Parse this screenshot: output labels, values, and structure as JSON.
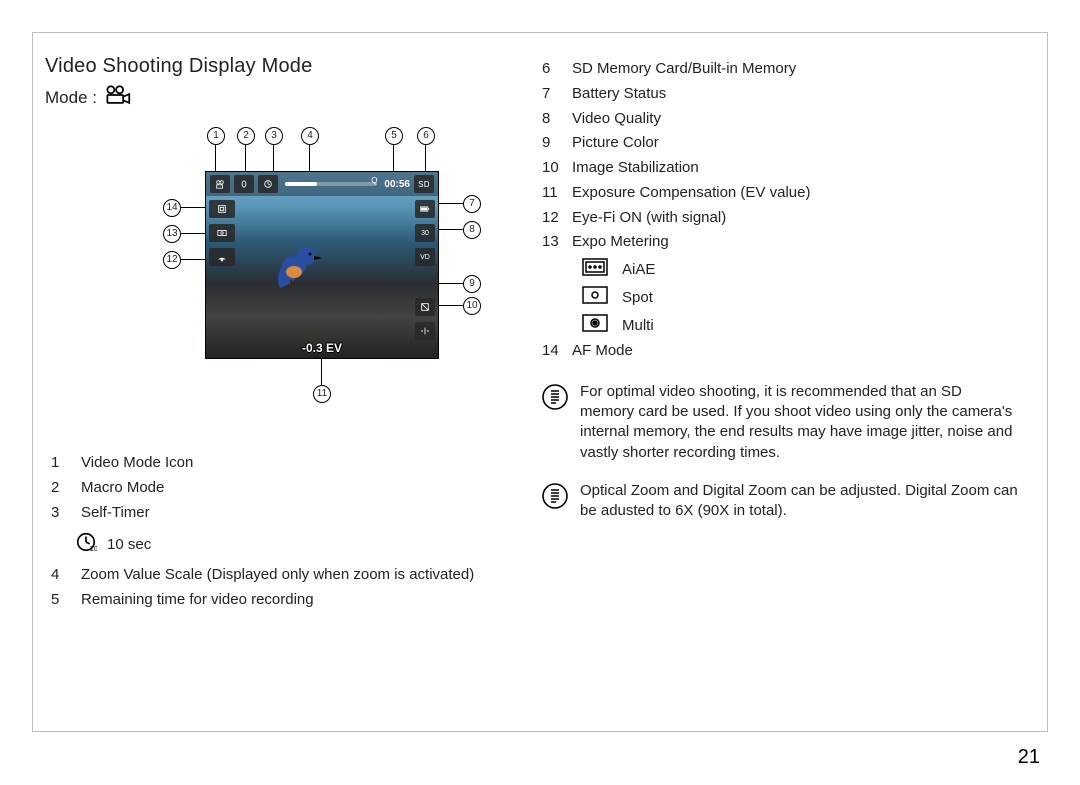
{
  "page_number": "21",
  "title": "Video Shooting Display Mode",
  "mode_label": "Mode :",
  "lcd": {
    "time": "00:56",
    "sd_label": "SD",
    "ev_text": "-0.3 EV",
    "thirty_label": "30",
    "vd_label": "VD"
  },
  "left_legend": [
    {
      "n": "1",
      "t": "Video Mode Icon"
    },
    {
      "n": "2",
      "t": "Macro Mode"
    },
    {
      "n": "3",
      "t": "Self-Timer"
    }
  ],
  "timer_sub": "10 sec",
  "left_legend_cont": [
    {
      "n": "4",
      "t": "Zoom Value Scale (Displayed only when zoom is activated)"
    },
    {
      "n": "5",
      "t": "Remaining time for video recording"
    }
  ],
  "right_legend_top": [
    {
      "n": "6",
      "t": "SD Memory Card/Built-in Memory"
    },
    {
      "n": "7",
      "t": "Battery Status"
    },
    {
      "n": "8",
      "t": "Video Quality"
    },
    {
      "n": "9",
      "t": "Picture Color"
    },
    {
      "n": "10",
      "t": "Image Stabilization"
    },
    {
      "n": "11",
      "t": "Exposure Compensation (EV value)"
    },
    {
      "n": "12",
      "t": "Eye-Fi ON (with signal)"
    },
    {
      "n": "13",
      "t": "Expo Metering"
    }
  ],
  "metering_modes": [
    {
      "k": "aiae",
      "t": "AiAE"
    },
    {
      "k": "spot",
      "t": "Spot"
    },
    {
      "k": "multi",
      "t": "Multi"
    }
  ],
  "right_legend_bottom": [
    {
      "n": "14",
      "t": "AF Mode"
    }
  ],
  "notes": [
    "For optimal video shooting, it is recommended that an SD memory card be used. If you shoot video using only the camera's internal memory, the end results may have image jitter, noise and vastly shorter recording times.",
    "Optical Zoom and Digital Zoom can be adjusted. Digital Zoom can be adusted to 6X (90X in total)."
  ],
  "callouts": [
    "1",
    "2",
    "3",
    "4",
    "5",
    "6",
    "7",
    "8",
    "9",
    "10",
    "11",
    "12",
    "13",
    "14"
  ]
}
